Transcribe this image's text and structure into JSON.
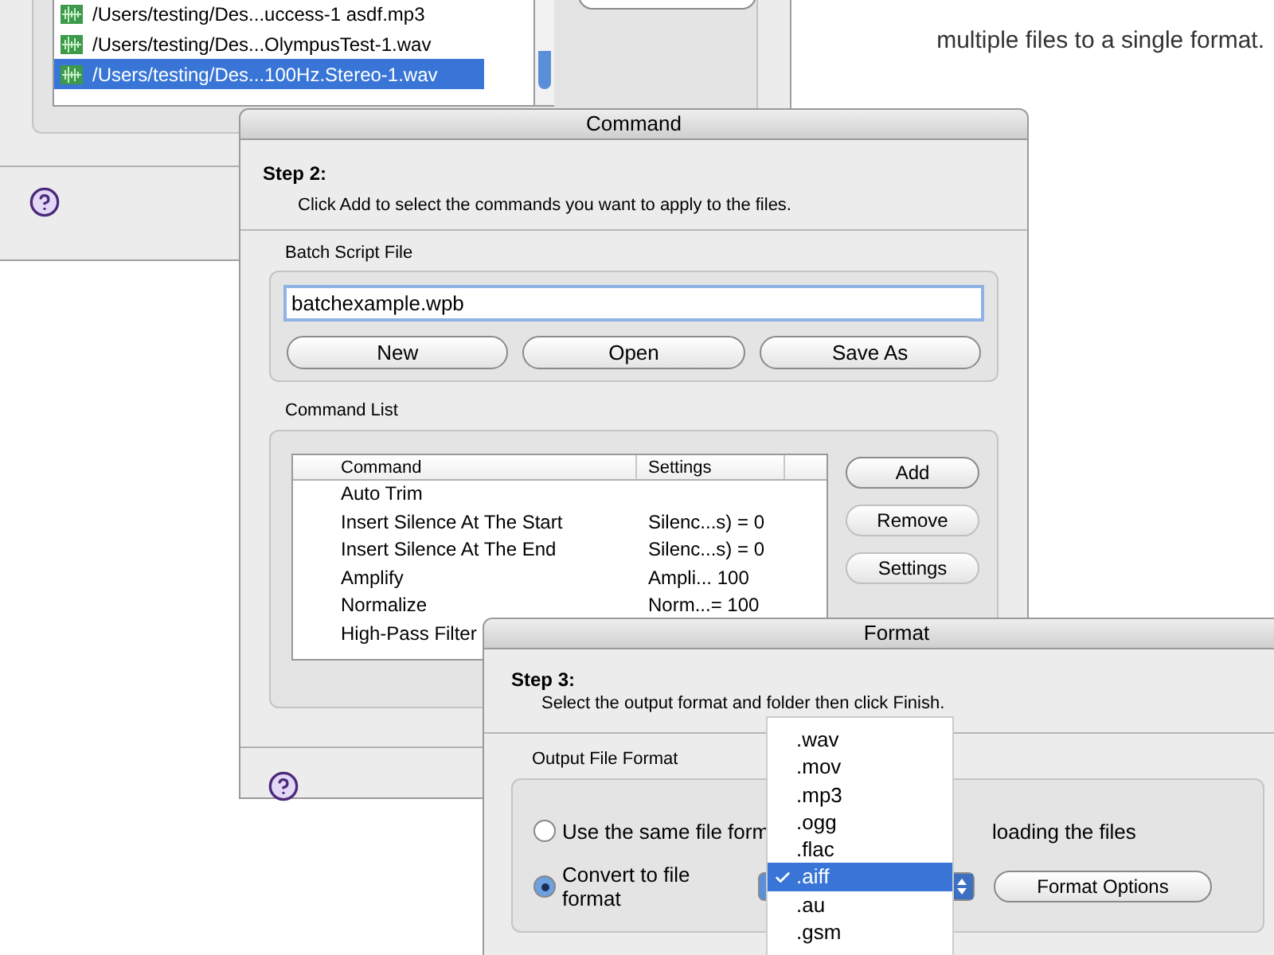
{
  "background_window": {
    "files": [
      {
        "name": "/Users/testing/Des...uccess-1  asdf.mp3",
        "selected": false
      },
      {
        "name": "/Users/testing/Des...OlympusTest-1.wav",
        "selected": false
      },
      {
        "name": "/Users/testing/Des...100Hz.Stereo-1.wav",
        "selected": true
      }
    ]
  },
  "caption": "multiple files to a single format.",
  "command_window": {
    "title": "Command",
    "step": "Step 2:",
    "instruction": "Click Add to select the commands you want to apply to the files.",
    "batch_script_file": {
      "label": "Batch Script File",
      "value": "batchexample.wpb",
      "buttons": [
        "New",
        "Open",
        "Save As"
      ]
    },
    "command_list": {
      "label": "Command List",
      "columns": [
        "Command",
        "Settings"
      ],
      "rows": [
        {
          "command": "Auto Trim"
        },
        {
          "command": "Insert Silence At The Start",
          "settings": "Silenc...s) = 0"
        },
        {
          "command": "Insert Silence At The End",
          "settings": "Silenc...s) = 0"
        },
        {
          "command": "Amplify",
          "settings": "Ampli... 100"
        },
        {
          "command": "Normalize",
          "settings": "Norm...= 100"
        },
        {
          "command": "High-Pass Filter"
        }
      ],
      "buttons": [
        {
          "label": "Add",
          "disabled": false
        },
        {
          "label": "Remove",
          "disabled": true
        },
        {
          "label": "Settings",
          "disabled": true
        }
      ]
    }
  },
  "format_window": {
    "title": "Format",
    "step": "Step 3:",
    "instruction": "Select the output format and folder then click Finish.",
    "output_file_format": {
      "label": "Output File Format",
      "options": [
        {
          "parts": [
            "Use the same file form",
            "loading the files"
          ],
          "selected": false
        },
        {
          "parts": [
            "Convert to file format"
          ],
          "selected": true
        }
      ],
      "format_menu": [
        {
          "label": ".wav",
          "selected": false
        },
        {
          "label": ".mov",
          "selected": false
        },
        {
          "label": ".mp3",
          "selected": false
        },
        {
          "label": ".ogg",
          "selected": false
        },
        {
          "label": ".flac",
          "selected": false
        },
        {
          "label": ".aiff",
          "selected": true
        },
        {
          "label": ".au",
          "selected": false
        },
        {
          "label": ".gsm",
          "selected": false
        }
      ],
      "format_options_button": "Format Options"
    }
  }
}
